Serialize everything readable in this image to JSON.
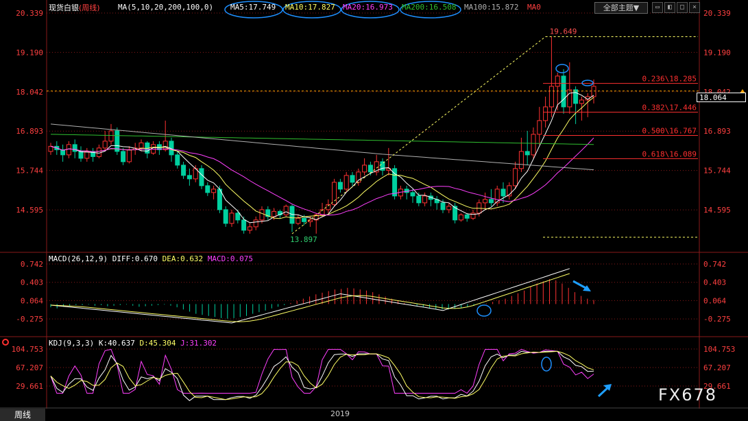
{
  "header": {
    "instrument": "现货白银",
    "period": "(周线)",
    "ma_params": "MA(5,10,20,200,100,0)",
    "ma5": "MA5:17.749",
    "ma10": "MA10:17.827",
    "ma20": "MA20:16.973",
    "ma200": "MA200:16.508",
    "ma100": "MA100:15.872",
    "ma0": "MA0",
    "theme_button": "全部主题▼"
  },
  "colors": {
    "up": "#ff3232",
    "down": "#00d0a0",
    "ma5": "#ffffff",
    "ma10": "#ffff66",
    "ma20": "#ff40ff",
    "ma200": "#30c030",
    "ma100": "#b0b0b0",
    "grid": "#8a1a1a",
    "circle": "#1e90ff"
  },
  "price_axis": {
    "left": [
      "20.339",
      "19.190",
      "18.042",
      "16.893",
      "15.744",
      "14.595"
    ],
    "right": [
      "20.339",
      "19.190",
      "18.042",
      "16.893",
      "15.744",
      "14.595"
    ],
    "current": "18.064"
  },
  "fib": {
    "high": "19.649",
    "low": "13.897",
    "levels": [
      "0.236\\18.285",
      "0.382\\17.446",
      "0.500\\16.767",
      "0.618\\16.089"
    ]
  },
  "macd": {
    "title": "MACD(26,12,9)",
    "diff": "DIFF:0.670",
    "dea": "DEA:0.632",
    "macd": "MACD:0.075",
    "axis": [
      "0.742",
      "0.403",
      "0.064",
      "-0.275"
    ]
  },
  "kdj": {
    "title": "KDJ(9,3,3)",
    "k": "K:40.637",
    "d": "D:45.304",
    "j": "J:31.302",
    "axis": [
      "104.753",
      "67.207",
      "29.661"
    ]
  },
  "footer": {
    "tab_label": "周线",
    "year": "2019",
    "watermark": "FX678"
  },
  "chart_data": {
    "type": "candlestick",
    "price_range": [
      13.6,
      20.6
    ],
    "candles": [
      [
        16.3,
        16.45,
        16.2,
        16.55
      ],
      [
        16.45,
        16.35,
        16.2,
        16.6
      ],
      [
        16.35,
        16.2,
        16.0,
        16.5
      ],
      [
        16.2,
        16.5,
        16.1,
        16.6
      ],
      [
        16.5,
        16.3,
        16.1,
        16.65
      ],
      [
        16.3,
        16.1,
        16.0,
        16.45
      ],
      [
        16.1,
        16.3,
        16.0,
        16.4
      ],
      [
        16.3,
        16.15,
        16.0,
        16.4
      ],
      [
        16.15,
        16.4,
        16.1,
        16.5
      ],
      [
        16.4,
        16.6,
        16.3,
        16.9
      ],
      [
        16.6,
        16.9,
        16.5,
        17.1
      ],
      [
        16.9,
        16.3,
        16.2,
        17.0
      ],
      [
        16.3,
        16.0,
        15.9,
        16.4
      ],
      [
        16.0,
        16.35,
        15.95,
        16.45
      ],
      [
        16.35,
        16.4,
        16.2,
        16.55
      ],
      [
        16.4,
        16.55,
        16.3,
        16.65
      ],
      [
        16.55,
        16.25,
        16.1,
        16.6
      ],
      [
        16.25,
        16.5,
        16.2,
        16.6
      ],
      [
        16.5,
        16.35,
        16.2,
        16.6
      ],
      [
        16.35,
        16.6,
        16.3,
        17.2
      ],
      [
        16.6,
        16.2,
        16.0,
        16.7
      ],
      [
        16.2,
        15.9,
        15.8,
        16.3
      ],
      [
        15.9,
        15.6,
        15.5,
        16.0
      ],
      [
        15.6,
        15.5,
        15.3,
        15.8
      ],
      [
        15.5,
        15.8,
        15.4,
        15.9
      ],
      [
        15.8,
        15.3,
        15.2,
        15.9
      ],
      [
        15.3,
        15.1,
        15.0,
        15.4
      ],
      [
        15.1,
        15.2,
        14.9,
        15.3
      ],
      [
        15.2,
        14.6,
        14.5,
        15.3
      ],
      [
        14.6,
        14.2,
        14.1,
        14.7
      ],
      [
        14.2,
        14.5,
        14.1,
        14.6
      ],
      [
        14.5,
        14.3,
        14.2,
        14.6
      ],
      [
        14.3,
        14.0,
        13.9,
        14.4
      ],
      [
        14.0,
        14.1,
        13.9,
        14.2
      ],
      [
        14.1,
        14.3,
        14.0,
        14.4
      ],
      [
        14.3,
        14.6,
        14.2,
        14.7
      ],
      [
        14.6,
        14.4,
        14.3,
        14.7
      ],
      [
        14.4,
        14.55,
        14.3,
        14.65
      ],
      [
        14.55,
        14.45,
        14.35,
        14.6
      ],
      [
        14.45,
        14.7,
        14.4,
        14.75
      ],
      [
        14.7,
        14.2,
        13.95,
        14.75
      ],
      [
        14.2,
        14.35,
        14.15,
        14.45
      ],
      [
        14.35,
        14.25,
        14.15,
        14.45
      ],
      [
        14.25,
        14.3,
        14.1,
        14.4
      ],
      [
        14.3,
        14.45,
        13.9,
        14.5
      ],
      [
        14.45,
        14.6,
        14.4,
        14.8
      ],
      [
        14.6,
        14.75,
        14.5,
        14.9
      ],
      [
        14.75,
        15.4,
        14.7,
        15.5
      ],
      [
        15.4,
        15.2,
        15.1,
        15.5
      ],
      [
        15.2,
        15.6,
        15.1,
        15.7
      ],
      [
        15.6,
        15.4,
        15.3,
        15.7
      ],
      [
        15.4,
        15.7,
        15.3,
        15.8
      ],
      [
        15.7,
        15.9,
        15.6,
        16.1
      ],
      [
        15.9,
        15.7,
        15.6,
        16.0
      ],
      [
        15.7,
        16.0,
        15.6,
        16.2
      ],
      [
        16.0,
        15.75,
        15.6,
        16.1
      ],
      [
        15.75,
        15.8,
        15.6,
        16.4
      ],
      [
        15.8,
        15.0,
        14.9,
        15.9
      ],
      [
        15.0,
        15.2,
        14.9,
        15.3
      ],
      [
        15.2,
        15.1,
        14.9,
        15.3
      ],
      [
        15.1,
        15.0,
        14.8,
        15.2
      ],
      [
        15.0,
        14.8,
        14.7,
        15.1
      ],
      [
        14.8,
        15.0,
        14.7,
        15.1
      ],
      [
        15.0,
        14.9,
        14.7,
        15.1
      ],
      [
        14.9,
        14.8,
        14.6,
        15.0
      ],
      [
        14.8,
        14.6,
        14.5,
        14.9
      ],
      [
        14.6,
        14.7,
        14.5,
        14.8
      ],
      [
        14.7,
        14.3,
        14.2,
        14.8
      ],
      [
        14.3,
        14.45,
        14.25,
        14.5
      ],
      [
        14.45,
        14.35,
        14.25,
        14.5
      ],
      [
        14.35,
        14.5,
        14.3,
        14.6
      ],
      [
        14.5,
        14.8,
        14.4,
        14.9
      ],
      [
        14.8,
        14.9,
        14.6,
        15.1
      ],
      [
        14.9,
        14.8,
        14.7,
        15.2
      ],
      [
        14.8,
        15.2,
        14.7,
        15.3
      ],
      [
        15.2,
        15.0,
        14.8,
        15.4
      ],
      [
        15.0,
        15.3,
        14.9,
        15.4
      ],
      [
        15.3,
        15.8,
        15.2,
        16.0
      ],
      [
        15.8,
        16.3,
        15.7,
        16.7
      ],
      [
        16.3,
        16.2,
        15.9,
        16.9
      ],
      [
        16.2,
        16.8,
        16.1,
        17.0
      ],
      [
        16.8,
        17.2,
        16.5,
        17.6
      ],
      [
        17.2,
        17.6,
        17.0,
        17.9
      ],
      [
        17.6,
        18.2,
        17.3,
        19.65
      ],
      [
        18.2,
        18.5,
        17.5,
        18.6
      ],
      [
        18.5,
        17.6,
        17.4,
        18.7
      ],
      [
        17.6,
        18.1,
        17.4,
        18.9
      ],
      [
        18.1,
        17.7,
        17.1,
        18.2
      ],
      [
        17.7,
        17.8,
        17.2,
        17.9
      ],
      [
        17.8,
        17.9,
        17.3,
        18.0
      ],
      [
        17.9,
        18.2,
        17.7,
        18.4
      ]
    ],
    "macd_hist": [
      -0.06,
      -0.08,
      -0.05,
      -0.03,
      -0.02,
      -0.02,
      -0.01,
      -0.03,
      -0.02,
      -0.04,
      -0.03,
      -0.02,
      -0.01,
      -0.03,
      -0.05,
      -0.04,
      -0.03,
      -0.02,
      -0.01,
      -0.03,
      -0.06,
      -0.1,
      -0.14,
      -0.18,
      -0.2,
      -0.22,
      -0.24,
      -0.26,
      -0.27,
      -0.26,
      -0.24,
      -0.22,
      -0.18,
      -0.15,
      -0.12,
      -0.08,
      -0.05,
      -0.02,
      0.02,
      0.06,
      0.1,
      0.14,
      0.18,
      0.21,
      0.24,
      0.27,
      0.28,
      0.3,
      0.29,
      0.27,
      0.25,
      0.22,
      0.18,
      0.14,
      0.1,
      0.06,
      0.02,
      -0.01,
      -0.03,
      -0.05,
      -0.07,
      -0.09,
      -0.1,
      -0.1,
      -0.09,
      -0.07,
      -0.05,
      -0.03,
      -0.01,
      0.01,
      0.04,
      0.07,
      0.1,
      0.15,
      0.2,
      0.25,
      0.32,
      0.38,
      0.42,
      0.46,
      0.44,
      0.38,
      0.3,
      0.22,
      0.15,
      0.1,
      0.075
    ]
  }
}
